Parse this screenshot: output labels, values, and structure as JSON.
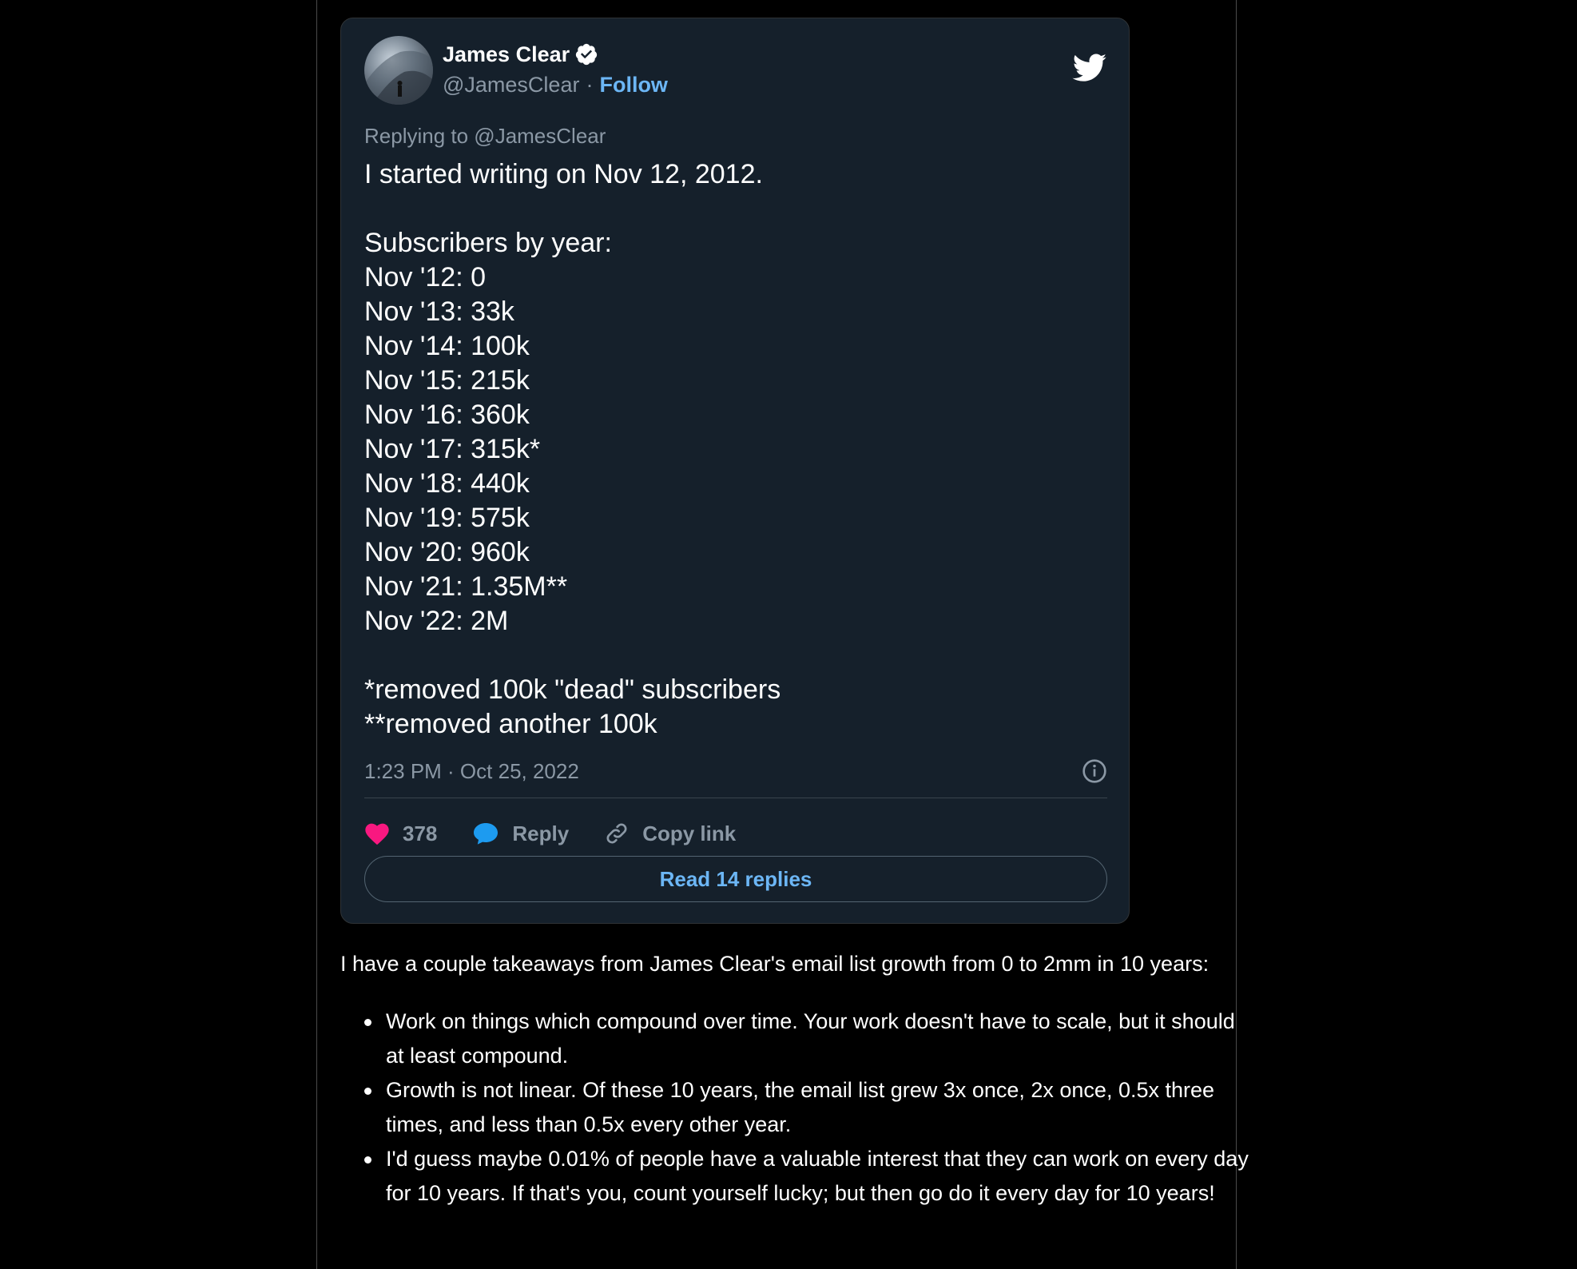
{
  "colors": {
    "page_background": "#000000",
    "card_background": "#15202b",
    "accent_blue": "#6cb6f5",
    "muted_text": "#8b98a5",
    "heart_pink": "#f91880",
    "reply_bubble_blue": "#1d9bf0"
  },
  "tweet": {
    "author_name": "James Clear",
    "handle": "@JamesClear",
    "separator": "·",
    "follow_label": "Follow",
    "replying_to": "Replying to @JamesClear",
    "lines": [
      "I started writing on Nov 12, 2012.",
      "",
      "Subscribers by year:",
      "Nov '12: 0",
      "Nov '13: 33k",
      "Nov '14: 100k",
      "Nov '15: 215k",
      "Nov '16: 360k",
      "Nov '17: 315k*",
      "Nov '18: 440k",
      "Nov '19: 575k",
      "Nov '20: 960k",
      "Nov '21: 1.35M**",
      "Nov '22: 2M",
      "",
      "*removed 100k \"dead\" subscribers",
      "**removed another 100k"
    ],
    "timestamp": "1:23 PM · Oct 25, 2022",
    "likes_count": "378",
    "reply_label": "Reply",
    "copy_link_label": "Copy link",
    "read_replies_label": "Read 14 replies",
    "icons": {
      "verified": "verified-badge-icon",
      "logo": "twitter-bird-icon",
      "info": "info-icon",
      "like": "heart-icon",
      "reply": "speech-bubble-icon",
      "copy_link": "link-icon"
    }
  },
  "article": {
    "intro": "I have a couple takeaways from James Clear's email list growth from 0 to 2mm in 10 years:",
    "takeaways": [
      "Work on things which compound over time. Your work doesn't have to scale, but it should at least compound.",
      "Growth is not linear. Of these 10 years, the email list grew 3x once, 2x once, 0.5x three times, and less than 0.5x every other year.",
      "I'd guess maybe 0.01% of people have a valuable interest that they can work on every day for 10 years. If that's you, count yourself lucky; but then go do it every day for 10 years!"
    ]
  }
}
